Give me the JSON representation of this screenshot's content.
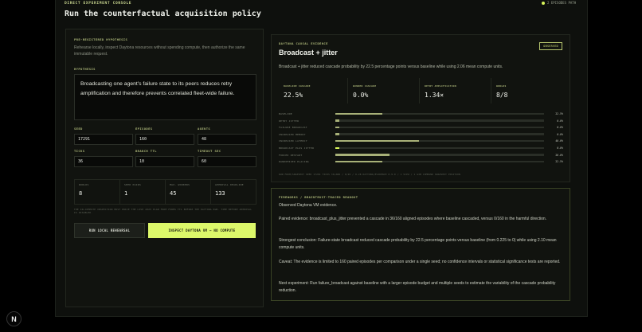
{
  "header": {
    "eyebrow": "DIRECT EXPERIMENT CONSOLE",
    "title": "Run the counterfactual acquisition policy",
    "status": "2 EPISODES PATH"
  },
  "hypothesis_panel": {
    "section_label": "PRE-REGISTERED HYPOTHESIS",
    "description": "Rehearse locally, inspect Daytona resources without spending compute, then authorize the same immutable request.",
    "hypothesis_label": "HYPOTHESIS",
    "hypothesis_text": "Broadcasting one agent's failure state to its peers reduces retry amplification and therefore prevents correlated fleet-wide failure.",
    "fields": [
      {
        "label": "SEED",
        "value": "17291"
      },
      {
        "label": "EPISODES",
        "value": "160"
      },
      {
        "label": "AGENTS",
        "value": "48"
      },
      {
        "label": "TICKS",
        "value": "36"
      },
      {
        "label": "BRANCH TTL",
        "value": "10"
      },
      {
        "label": "TIMEOUT SEC",
        "value": "60"
      }
    ],
    "stats": [
      {
        "label": "WORLDS",
        "value": "8"
      },
      {
        "label": "SEED PAIRS",
        "value": "1"
      },
      {
        "label": "MAX. WORKERS",
        "value": "45"
      },
      {
        "label": "APPROVAL DEADLINE",
        "value": "133"
      }
    ],
    "fine_print": "THE IN-COMPUTE INSPECTION MUST PRICE THE LIVE 2025 PLAN FROM FORMS TTL BEFORE THE DAYTONA RUN. TIME BEFORE APPROVAL IS DISABLED.",
    "btn_local": "RUN LOCAL REHEARSAL",
    "btn_inspect": "INSPECT DAYTONA VM — NO COMPUTE"
  },
  "evidence": {
    "section_label": "DAYTONA CAUSAL EVIDENCE",
    "badge": "OBSERVED",
    "title": "Broadcast + jitter",
    "summary": "Broadcast + jitter reduced cascade probability by 22.5 percentage points versus baseline while using 2.06 mean compute units.",
    "metrics": [
      {
        "label": "BASELINE CASCADE",
        "value": "22.5%"
      },
      {
        "label": "WINNER CASCADE",
        "value": "0.0%"
      },
      {
        "label": "RETRY AMPLIFICATION",
        "value": "1.34×"
      },
      {
        "label": "WORLDS",
        "value": "8/8"
      }
    ],
    "rows": [
      {
        "label": "BASELINE",
        "value": "22.5%",
        "fraction": 0.225
      },
      {
        "label": "RETRY JITTER",
        "value": "0.0%",
        "fraction": 0.02
      },
      {
        "label": "FAILURE BROADCAST",
        "value": "0.0%",
        "fraction": 0.02
      },
      {
        "label": "INCREASED MEMORY",
        "value": "0.0%",
        "fraction": 0.02
      },
      {
        "label": "INCREASED LATENCY",
        "value": "40.0%",
        "fraction": 0.4
      },
      {
        "label": "BROADCAST PLUS JITTER",
        "value": "0.0%",
        "fraction": 0.02
      },
      {
        "label": "FORCED RESTART",
        "value": "26.0%",
        "fraction": 0.26
      },
      {
        "label": "RANDOMIZED PLACING",
        "value": "22.5%",
        "fraction": 0.225
      }
    ],
    "footnote": "RUN FROM/SNAPSHOT   SEED 17291   TICKS 36/ARR / 9/20 / 0.28   DAYTONA/EVIDENCE 0.9.0 / 1 VCPU / 1 GIB   COMMAND SNAPSHOT POSITION"
  },
  "findings": {
    "section_label": "FIREWORKS / BRAINTRUST-TRACED READOUT",
    "paragraphs": [
      "Observed Daytona VM evidence.",
      "Paired evidence: broadcast_plus_jitter prevented a cascade in 36/160 aligned episodes where baseline cascaded, versus 0/160 in the harmful direction.",
      "Strongest conclusion: Failure-state broadcast reduced cascade probability by 22.5 percentage points versus baseline (from 0.225 to 0) while using 2.10 mean compute units.",
      "Caveat: The evidence is limited to 160 paired episodes per comparison under a single seed; no confidence intervals or statistical significance tests are reported.",
      "Next experiment: Run failure_broadcast against baseline with a larger episode budget and multiple seeds to estimate the variability of the cascade probability reduction."
    ]
  },
  "logo": "N",
  "colors": {
    "accent": "#d8f55a",
    "background": "#0e100d",
    "bar": "#a8b178"
  }
}
